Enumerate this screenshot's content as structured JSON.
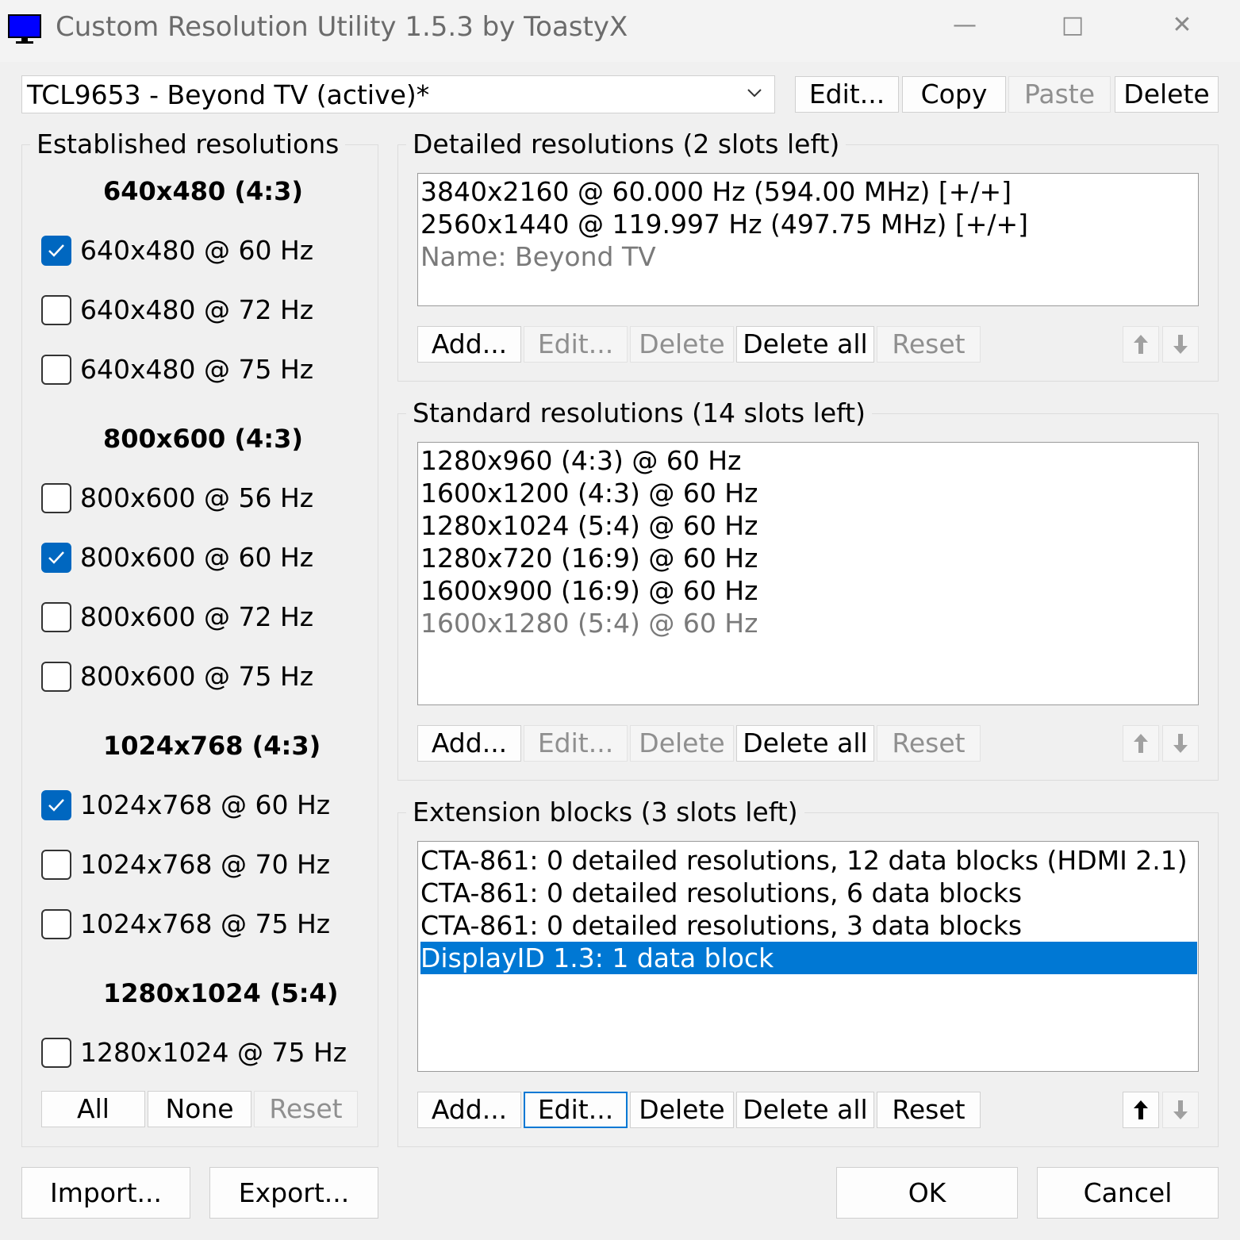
{
  "window": {
    "title": "Custom Resolution Utility 1.5.3 by ToastyX",
    "icon": "monitor-icon",
    "minimize": "—",
    "maximize": "□",
    "close": "✕"
  },
  "display_select": {
    "value": "TCL9653 - Beyond TV (active)*"
  },
  "top_buttons": {
    "edit": "Edit...",
    "copy": "Copy",
    "paste": "Paste",
    "delete": "Delete"
  },
  "established": {
    "title": "Established resolutions",
    "groups": [
      {
        "header": "640x480 (4:3)",
        "items": [
          {
            "label": "640x480 @ 60 Hz",
            "checked": true
          },
          {
            "label": "640x480 @ 72 Hz",
            "checked": false
          },
          {
            "label": "640x480 @ 75 Hz",
            "checked": false
          }
        ]
      },
      {
        "header": "800x600 (4:3)",
        "items": [
          {
            "label": "800x600 @ 56 Hz",
            "checked": false
          },
          {
            "label": "800x600 @ 60 Hz",
            "checked": true
          },
          {
            "label": "800x600 @ 72 Hz",
            "checked": false
          },
          {
            "label": "800x600 @ 75 Hz",
            "checked": false
          }
        ]
      },
      {
        "header": "1024x768 (4:3)",
        "items": [
          {
            "label": "1024x768 @ 60 Hz",
            "checked": true
          },
          {
            "label": "1024x768 @ 70 Hz",
            "checked": false
          },
          {
            "label": "1024x768 @ 75 Hz",
            "checked": false
          }
        ]
      },
      {
        "header": "1280x1024 (5:4)",
        "items": [
          {
            "label": "1280x1024 @ 75 Hz",
            "checked": false
          }
        ]
      }
    ],
    "buttons": {
      "all": "All",
      "none": "None",
      "reset": "Reset"
    }
  },
  "detailed": {
    "title": "Detailed resolutions (2 slots left)",
    "items": [
      {
        "text": "3840x2160 @ 60.000 Hz (594.00 MHz) [+/+]"
      },
      {
        "text": "2560x1440 @ 119.997 Hz (497.75 MHz) [+/+]"
      },
      {
        "text": "Name: Beyond TV"
      }
    ],
    "buttons": {
      "add": "Add...",
      "edit": "Edit...",
      "delete": "Delete",
      "delete_all": "Delete all",
      "reset": "Reset"
    }
  },
  "standard": {
    "title": "Standard resolutions (14 slots left)",
    "items": [
      {
        "text": "1280x960 (4:3) @ 60 Hz"
      },
      {
        "text": "1600x1200 (4:3) @ 60 Hz"
      },
      {
        "text": "1280x1024 (5:4) @ 60 Hz"
      },
      {
        "text": "1280x720 (16:9) @ 60 Hz"
      },
      {
        "text": "1600x900 (16:9) @ 60 Hz"
      },
      {
        "text": "1600x1280 (5:4) @ 60 Hz"
      }
    ],
    "buttons": {
      "add": "Add...",
      "edit": "Edit...",
      "delete": "Delete",
      "delete_all": "Delete all",
      "reset": "Reset"
    }
  },
  "extension": {
    "title": "Extension blocks (3 slots left)",
    "items": [
      {
        "text": "CTA-861: 0 detailed resolutions, 12 data blocks (HDMI 2.1)"
      },
      {
        "text": "CTA-861: 0 detailed resolutions, 6 data blocks"
      },
      {
        "text": "CTA-861: 0 detailed resolutions, 3 data blocks"
      },
      {
        "text": "DisplayID 1.3: 1 data block"
      }
    ],
    "selected_index": 3,
    "buttons": {
      "add": "Add...",
      "edit": "Edit...",
      "delete": "Delete",
      "delete_all": "Delete all",
      "reset": "Reset"
    }
  },
  "bottom": {
    "import": "Import...",
    "export": "Export...",
    "ok": "OK",
    "cancel": "Cancel"
  },
  "colors": {
    "accent": "#0078d4",
    "checkbox": "#0067c0",
    "background": "#f0f0f0"
  }
}
